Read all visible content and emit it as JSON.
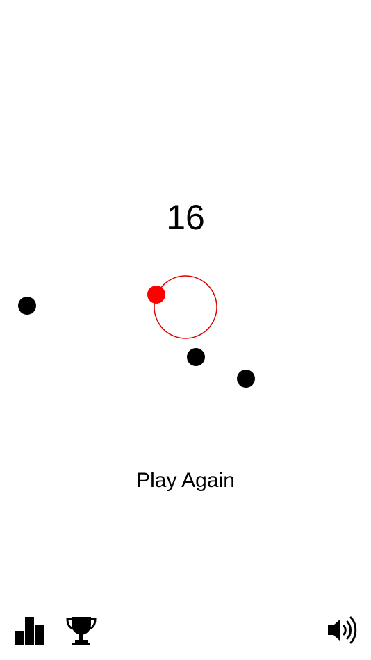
{
  "score": "16",
  "play_again_label": "Play Again",
  "colors": {
    "background": "#ffffff",
    "player": "#ff0000",
    "orbit": "#e00000",
    "obstacle": "#000000"
  },
  "icons": {
    "leaderboard": "leaderboard-icon",
    "achievements": "trophy-icon",
    "sound": "speaker-volume-icon"
  }
}
